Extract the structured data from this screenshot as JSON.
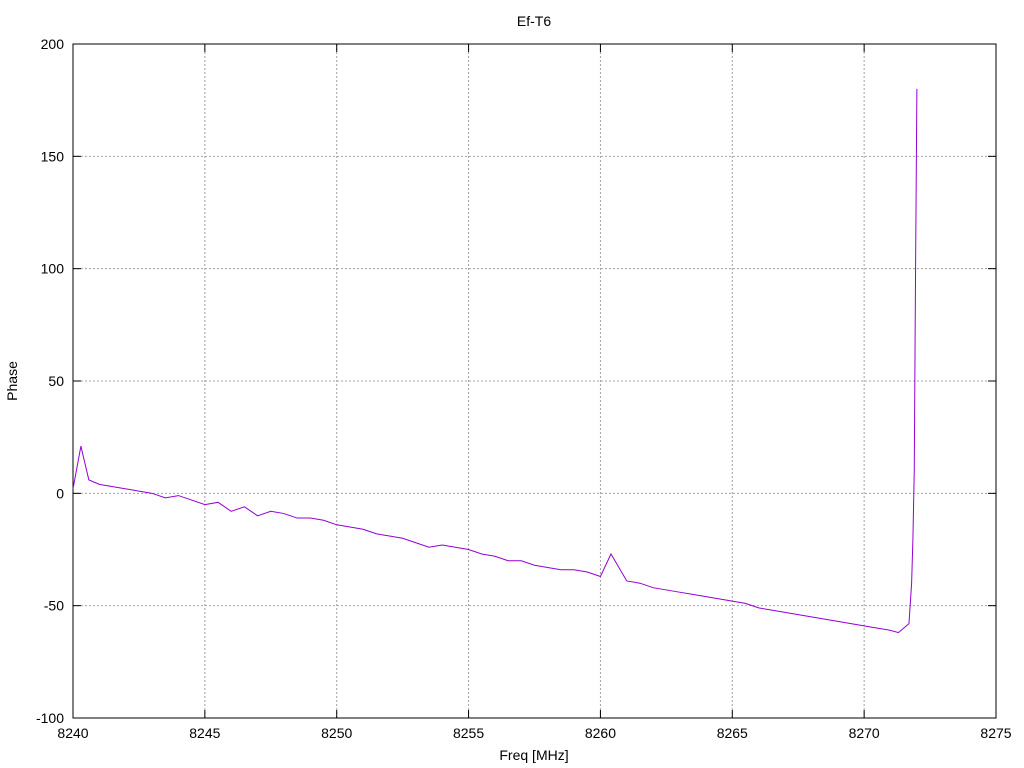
{
  "chart_data": {
    "type": "line",
    "title": "Ef-T6",
    "xlabel": "Freq [MHz]",
    "ylabel": "Phase",
    "xlim": [
      8240,
      8275
    ],
    "ylim": [
      -100,
      200
    ],
    "x_ticks": [
      8240,
      8245,
      8250,
      8255,
      8260,
      8265,
      8270,
      8275
    ],
    "y_ticks": [
      -100,
      -50,
      0,
      50,
      100,
      150,
      200
    ],
    "grid": true,
    "legend": "none",
    "series": [
      {
        "color": "#9400d3",
        "x": [
          8240.0,
          8240.3,
          8240.6,
          8241.0,
          8241.5,
          8242.0,
          8242.5,
          8243.0,
          8243.5,
          8244.0,
          8244.5,
          8245.0,
          8245.5,
          8246.0,
          8246.5,
          8247.0,
          8247.5,
          8248.0,
          8248.5,
          8249.0,
          8249.5,
          8250.0,
          8250.5,
          8251.0,
          8251.5,
          8252.0,
          8252.5,
          8253.0,
          8253.5,
          8254.0,
          8254.5,
          8255.0,
          8255.5,
          8256.0,
          8256.5,
          8257.0,
          8257.5,
          8258.0,
          8258.5,
          8259.0,
          8259.5,
          8260.0,
          8260.4,
          8261.0,
          8261.5,
          8262.0,
          8262.5,
          8263.0,
          8263.5,
          8264.0,
          8264.5,
          8265.0,
          8265.5,
          8266.0,
          8266.5,
          8267.0,
          8267.5,
          8268.0,
          8268.5,
          8269.0,
          8269.5,
          8270.0,
          8270.5,
          8271.0,
          8271.3,
          8271.5,
          8271.7,
          8271.8,
          8271.85,
          8271.9,
          8271.95,
          8272.0
        ],
        "values": [
          2,
          21,
          6,
          4,
          3,
          2,
          1,
          0,
          -2,
          -1,
          -3,
          -5,
          -4,
          -8,
          -6,
          -10,
          -8,
          -9,
          -11,
          -11,
          -12,
          -14,
          -15,
          -16,
          -18,
          -19,
          -20,
          -22,
          -24,
          -23,
          -24,
          -25,
          -27,
          -28,
          -30,
          -30,
          -32,
          -33,
          -34,
          -34,
          -35,
          -37,
          -27,
          -39,
          -40,
          -42,
          -43,
          -44,
          -45,
          -46,
          -47,
          -48,
          -49,
          -51,
          -52,
          -53,
          -54,
          -55,
          -56,
          -57,
          -58,
          -59,
          -60,
          -61,
          -62,
          -60,
          -58,
          -40,
          -20,
          10,
          100,
          180
        ]
      }
    ]
  }
}
